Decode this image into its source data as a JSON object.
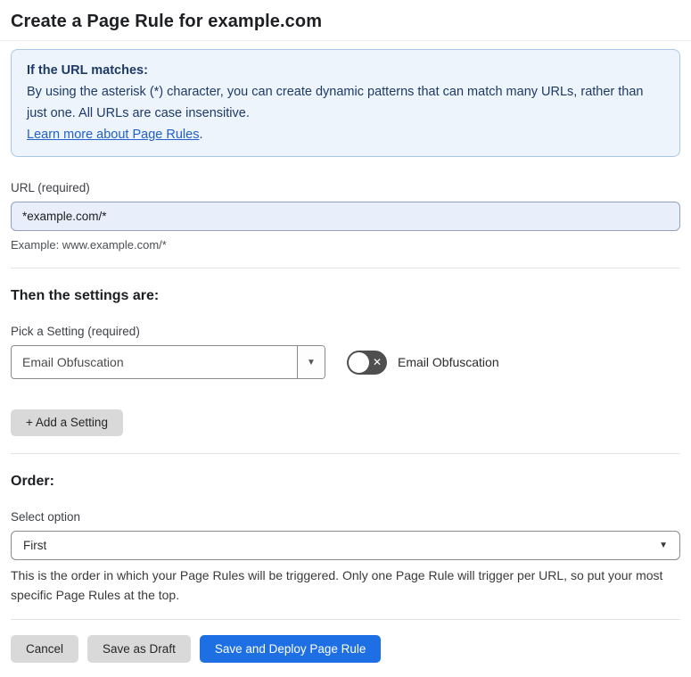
{
  "page": {
    "title": "Create a Page Rule for example.com"
  },
  "info_box": {
    "heading": "If the URL matches:",
    "body": "By using the asterisk (*) character, you can create dynamic patterns that can match many URLs, rather than just one. All URLs are case insensitive.",
    "link_label": "Learn more about Page Rules",
    "link_suffix": "."
  },
  "url_field": {
    "label": "URL (required)",
    "value": "*example.com/*",
    "helper": "Example: www.example.com/*"
  },
  "settings_section": {
    "heading": "Then the settings are:",
    "picker_label": "Pick a Setting (required)",
    "picker_value": "Email Obfuscation",
    "toggle_label": "Email Obfuscation",
    "toggle_state": "off",
    "add_button_label": "+ Add a Setting"
  },
  "order_section": {
    "heading": "Order:",
    "select_label": "Select option",
    "select_value": "First",
    "helper": "This is the order in which your Page Rules will be triggered. Only one Page Rule will trigger per URL, so put your most specific Page Rules at the top."
  },
  "footer": {
    "cancel_label": "Cancel",
    "save_draft_label": "Save as Draft",
    "save_deploy_label": "Save and Deploy Page Rule"
  },
  "icons": {
    "toggle_off_x": "✕",
    "dropdown_arrow": "▼"
  },
  "colors": {
    "accent_blue": "#1d6fe3",
    "info_box_bg": "#eef4fb",
    "info_box_border": "#a9c7e8",
    "info_text": "#1e3a66",
    "link_blue": "#2161c9",
    "url_input_bg": "#e9eefb",
    "toggle_off_bg": "#4f4f4f",
    "gray_button_bg": "#d9d9d9"
  }
}
